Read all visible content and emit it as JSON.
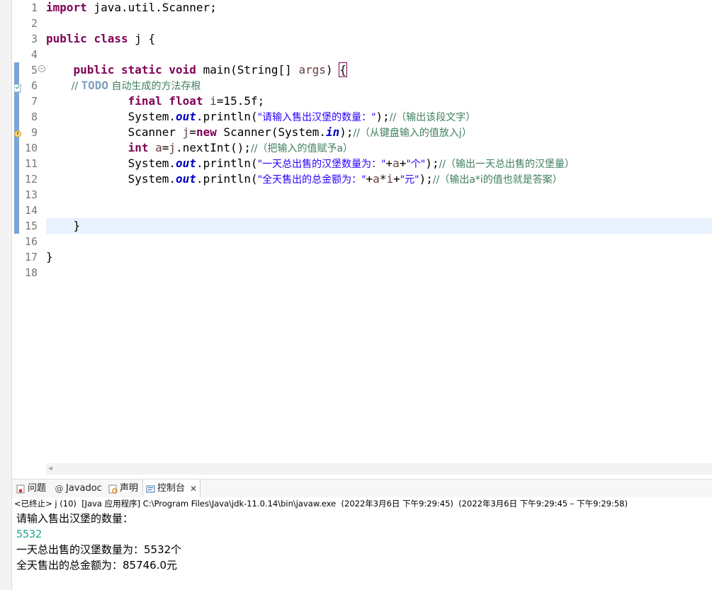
{
  "editor": {
    "lines": [
      {
        "num": "1",
        "parts": [
          {
            "t": "import",
            "c": "kw"
          },
          {
            "t": " java.util.Scanner;",
            "c": ""
          }
        ]
      },
      {
        "num": "2",
        "parts": []
      },
      {
        "num": "3",
        "parts": [
          {
            "t": "public",
            "c": "kw"
          },
          {
            "t": " ",
            "c": ""
          },
          {
            "t": "class",
            "c": "kw"
          },
          {
            "t": " j {",
            "c": ""
          }
        ]
      },
      {
        "num": "4",
        "parts": []
      },
      {
        "num": "5",
        "parts": [
          {
            "t": "    ",
            "c": ""
          },
          {
            "t": "public",
            "c": "kw"
          },
          {
            "t": " ",
            "c": ""
          },
          {
            "t": "static",
            "c": "kw"
          },
          {
            "t": " ",
            "c": ""
          },
          {
            "t": "void",
            "c": "kw"
          },
          {
            "t": " main(String[] ",
            "c": ""
          },
          {
            "t": "args",
            "c": "var"
          },
          {
            "t": ") ",
            "c": ""
          },
          {
            "t": "{",
            "c": "bracket"
          }
        ]
      },
      {
        "num": "6",
        "parts": [
          {
            "t": "        // ",
            "c": "cmt"
          },
          {
            "t": "TODO",
            "c": "todo"
          },
          {
            "t": " 自动生成的方法存根",
            "c": "cmt"
          }
        ]
      },
      {
        "num": "7",
        "parts": [
          {
            "t": "            ",
            "c": ""
          },
          {
            "t": "final",
            "c": "kw"
          },
          {
            "t": " ",
            "c": ""
          },
          {
            "t": "float",
            "c": "kw"
          },
          {
            "t": " ",
            "c": ""
          },
          {
            "t": "i",
            "c": "var"
          },
          {
            "t": "=15.5f;",
            "c": ""
          }
        ]
      },
      {
        "num": "8",
        "parts": [
          {
            "t": "            System.",
            "c": ""
          },
          {
            "t": "out",
            "c": "fld"
          },
          {
            "t": ".println(",
            "c": ""
          },
          {
            "t": "\"请输入售出汉堡的数量：\"",
            "c": "str"
          },
          {
            "t": ");",
            "c": ""
          },
          {
            "t": "//（输出该段文字）",
            "c": "cmt"
          }
        ]
      },
      {
        "num": "9",
        "parts": [
          {
            "t": "            Scanner ",
            "c": ""
          },
          {
            "t": "j",
            "c": "var"
          },
          {
            "t": "=",
            "c": ""
          },
          {
            "t": "new",
            "c": "kw"
          },
          {
            "t": " Scanner(System.",
            "c": ""
          },
          {
            "t": "in",
            "c": "fld"
          },
          {
            "t": ");",
            "c": ""
          },
          {
            "t": "//（从键盘输入的值放入j）",
            "c": "cmt"
          }
        ]
      },
      {
        "num": "10",
        "parts": [
          {
            "t": "            ",
            "c": ""
          },
          {
            "t": "int",
            "c": "kw"
          },
          {
            "t": " ",
            "c": ""
          },
          {
            "t": "a",
            "c": "var"
          },
          {
            "t": "=",
            "c": ""
          },
          {
            "t": "j",
            "c": "var"
          },
          {
            "t": ".nextInt();",
            "c": ""
          },
          {
            "t": "//（把输入的值赋予a）",
            "c": "cmt"
          }
        ]
      },
      {
        "num": "11",
        "parts": [
          {
            "t": "            System.",
            "c": ""
          },
          {
            "t": "out",
            "c": "fld"
          },
          {
            "t": ".println(",
            "c": ""
          },
          {
            "t": "\"一天总出售的汉堡数量为：\"",
            "c": "str"
          },
          {
            "t": "+",
            "c": ""
          },
          {
            "t": "a",
            "c": "var"
          },
          {
            "t": "+",
            "c": ""
          },
          {
            "t": "\"个\"",
            "c": "str"
          },
          {
            "t": ");",
            "c": ""
          },
          {
            "t": "//（输出一天总出售的汉堡量）",
            "c": "cmt"
          }
        ]
      },
      {
        "num": "12",
        "parts": [
          {
            "t": "            System.",
            "c": ""
          },
          {
            "t": "out",
            "c": "fld"
          },
          {
            "t": ".println(",
            "c": ""
          },
          {
            "t": "\"全天售出的总金额为：\"",
            "c": "str"
          },
          {
            "t": "+",
            "c": ""
          },
          {
            "t": "a",
            "c": "var"
          },
          {
            "t": "*",
            "c": ""
          },
          {
            "t": "i",
            "c": "var"
          },
          {
            "t": "+",
            "c": ""
          },
          {
            "t": "\"元\"",
            "c": "str"
          },
          {
            "t": ");",
            "c": ""
          },
          {
            "t": "//（输出a*i的值也就是答案）",
            "c": "cmt"
          }
        ]
      },
      {
        "num": "13",
        "parts": []
      },
      {
        "num": "14",
        "parts": []
      },
      {
        "num": "15",
        "parts": [
          {
            "t": "    }",
            "c": ""
          }
        ]
      },
      {
        "num": "16",
        "parts": []
      },
      {
        "num": "17",
        "parts": [
          {
            "t": "}",
            "c": ""
          }
        ]
      },
      {
        "num": "18",
        "parts": []
      }
    ]
  },
  "tabs": {
    "problems": "问题",
    "javadoc": "Javadoc",
    "declaration": "声明",
    "console": "控制台",
    "close": "✕"
  },
  "console": {
    "status": "<已终止> j (10)  [Java 应用程序] C:\\Program Files\\Java\\jdk-11.0.14\\bin\\javaw.exe  (2022年3月6日 下午9:29:45)  (2022年3月6日 下午9:29:45 – 下午9:29:58)",
    "lines": [
      {
        "text": "请输入售出汉堡的数量：",
        "kind": "output"
      },
      {
        "text": "5532",
        "kind": "input"
      },
      {
        "text": "一天总出售的汉堡数量为：5532个",
        "kind": "output"
      },
      {
        "text": "全天售出的总金额为：85746.0元",
        "kind": "output"
      }
    ]
  },
  "colors": {
    "keyword": "#7f0055",
    "string": "#2a00ff",
    "comment": "#3f7f5f",
    "field": "#0000c0",
    "console_input": "#1fa890",
    "current_line": "#e8f2fe"
  }
}
